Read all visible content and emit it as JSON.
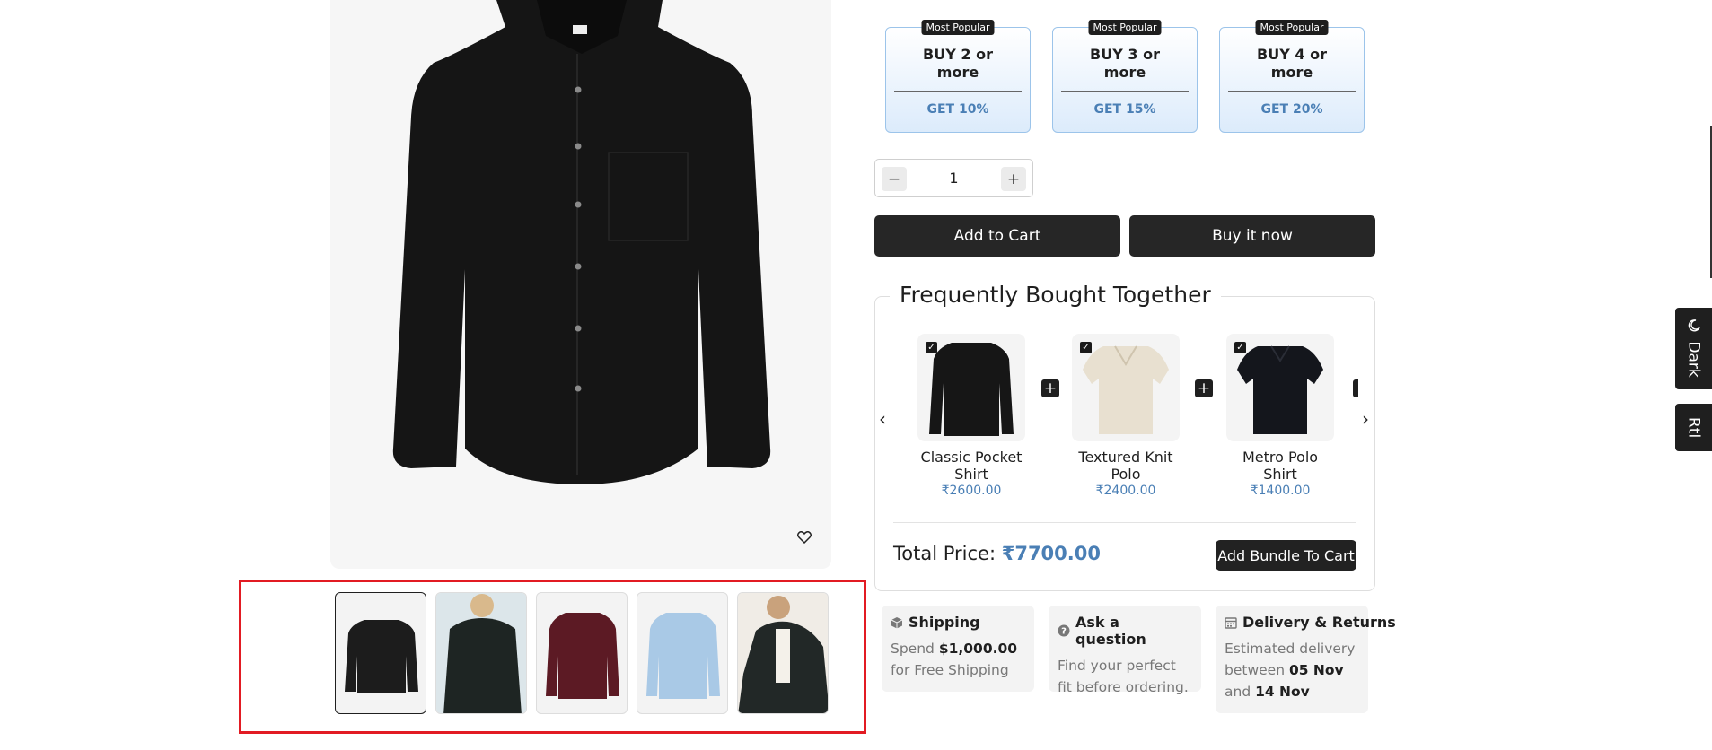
{
  "gallery": {
    "thumbnails": [
      {
        "alt": "black shirt front",
        "color": "#1c1c1c"
      },
      {
        "alt": "black shirt worn back",
        "color": "#1e2523"
      },
      {
        "alt": "burgundy shirt",
        "color": "#5c1a24"
      },
      {
        "alt": "light blue shirt",
        "color": "#a9c9e6"
      },
      {
        "alt": "model wearing black shirt",
        "color": "#222827"
      }
    ]
  },
  "offers": [
    {
      "badge": "Most Popular",
      "title": "BUY 2 or more",
      "discount": "GET 10%"
    },
    {
      "badge": "Most Popular",
      "title": "BUY 3 or more",
      "discount": "GET 15%"
    },
    {
      "badge": "Most Popular",
      "title": "BUY 4 or more",
      "discount": "GET 20%"
    }
  ],
  "quantity": {
    "value": "1",
    "minus": "−",
    "plus": "+"
  },
  "actions": {
    "add_to_cart": "Add to Cart",
    "buy_now": "Buy it now"
  },
  "fbt": {
    "title": "Frequently Bought Together",
    "items": [
      {
        "name": "Classic Pocket Shirt",
        "price": "₹2600.00",
        "checked": true
      },
      {
        "name": "Textured Knit Polo",
        "price": "₹2400.00",
        "checked": true
      },
      {
        "name": "Metro Polo Shirt",
        "price": "₹1400.00",
        "checked": true
      }
    ],
    "total_label": "Total Price:",
    "total_value": "₹7700.00",
    "bundle_button": "Add Bundle To Cart"
  },
  "info_cards": {
    "shipping": {
      "title": "Shipping",
      "pre": "Spend ",
      "amount": "$1,000.00",
      "post": " for Free Shipping"
    },
    "question": {
      "title": "Ask a question",
      "body": "Find your perfect fit before ordering."
    },
    "delivery": {
      "title": "Delivery & Returns",
      "pre": "Estimated delivery between ",
      "date1": "05 Nov",
      "mid": " and ",
      "date2": "14 Nov"
    }
  },
  "side_tabs": {
    "dark": "Dark",
    "rtl": "Rtl"
  },
  "colors": {
    "accent": "#4a7fb5",
    "dark": "#1f1f1f",
    "highlight": "#e21b23"
  }
}
